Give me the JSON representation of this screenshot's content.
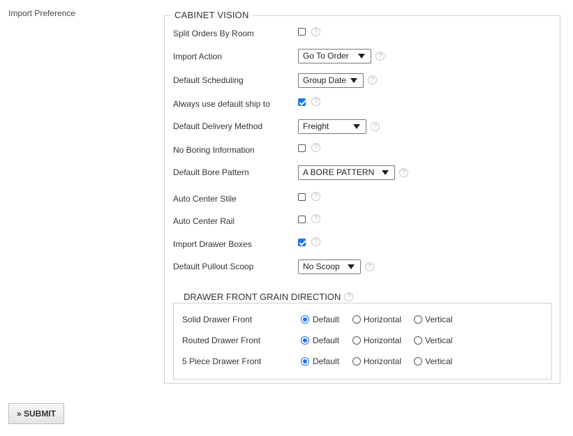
{
  "side_label": "Import Preference",
  "section": {
    "title": "CABINET VISION",
    "rows": [
      {
        "label": "Split Orders By Room",
        "type": "checkbox",
        "checked": false
      },
      {
        "label": "Import Action",
        "type": "select",
        "value": "Go To Order"
      },
      {
        "label": "Default Scheduling",
        "type": "select",
        "value": "Group Date"
      },
      {
        "label": "Always use default ship to",
        "type": "checkbox",
        "checked": true
      },
      {
        "label": "Default Delivery Method",
        "type": "select",
        "value": "Freight"
      },
      {
        "label": "No Boring Information",
        "type": "checkbox",
        "checked": false
      },
      {
        "label": "Default Bore Pattern",
        "type": "select",
        "value": "A BORE PATTERN"
      },
      {
        "label": "Auto Center Stile",
        "type": "checkbox",
        "checked": false
      },
      {
        "label": "Auto Center Rail",
        "type": "checkbox",
        "checked": false
      },
      {
        "label": "Import Drawer Boxes",
        "type": "checkbox",
        "checked": true
      },
      {
        "label": "Default Pullout Scoop",
        "type": "select",
        "value": "No Scoop"
      }
    ],
    "help_glyph": "?"
  },
  "grain": {
    "title": "DRAWER FRONT GRAIN DIRECTION",
    "options": [
      "Default",
      "Horizontal",
      "Vertical"
    ],
    "rows": [
      {
        "label": "Solid Drawer Front",
        "selected": "Default"
      },
      {
        "label": "Routed Drawer Front",
        "selected": "Default"
      },
      {
        "label": "5 Piece Drawer Front",
        "selected": "Default"
      }
    ]
  },
  "submit_label": "» SUBMIT",
  "colors": {
    "accent": "#1a73e8",
    "border": "#cfcfcf"
  },
  "icons": {
    "help": "help-circle-icon",
    "select_caret": "caret-down-icon",
    "checkbox_checked": "check-icon"
  }
}
